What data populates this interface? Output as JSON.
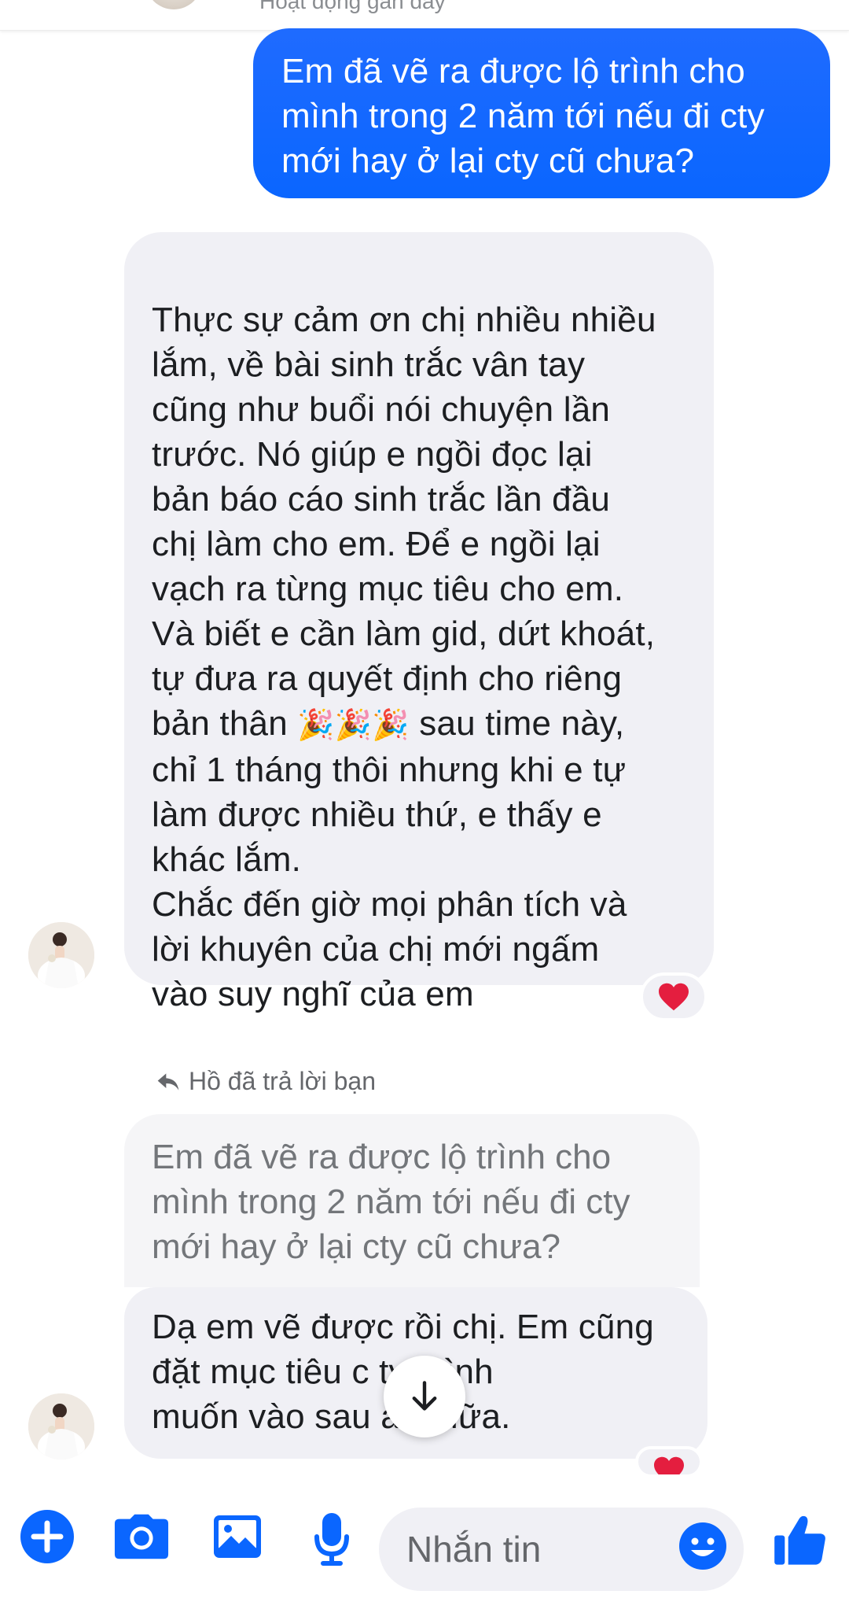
{
  "header": {
    "status_text": "Hoạt động gần đây"
  },
  "messages": {
    "outgoing_1": "Em đã vẽ ra được lộ trình cho\nmình trong 2 năm tới nếu đi cty\nmới hay ở lại cty cũ chưa?",
    "incoming_1": {
      "lines": [
        "Thực sự cảm ơn chị nhiều nhiều",
        "lắm, về bài sinh trắc vân tay",
        "cũng như buổi nói chuyện lần",
        "trước. Nó giúp e ngồi đọc lại",
        "bản báo cáo sinh trắc lần đầu",
        "chị làm cho em. Để e ngồi lại",
        "vạch ra từng mục tiêu cho em.",
        "Và biết e cần làm gid, dứt khoát,",
        "tự đưa ra quyết định cho riêng"
      ],
      "emoji_line_before": "bản thân ",
      "emojis": "🎉🎉🎉",
      "emoji_line_after": " sau time này,",
      "lines_after": [
        "chỉ 1 tháng thôi nhưng khi e tự",
        "làm được nhiều thứ, e thấy e",
        "khác lắm.",
        "Chắc đến giờ mọi phân tích và",
        "lời khuyên của chị mới ngấm",
        "vào suy nghĩ của em"
      ],
      "reaction": "heart"
    },
    "reply_label": "Hồ đã trả lời bạn",
    "quoted": "Em đã vẽ ra được lộ trình cho\nmình trong 2 năm tới nếu đi cty\nmới hay ở lại cty cũ chưa?",
    "incoming_2": "Dạ em vẽ được rồi chị. Em cũng\nđặt mục tiêu c      ty mình\nmuốn vào sau      ăm nữa.",
    "incoming_2_reaction": "heart"
  },
  "composer": {
    "placeholder": "Nhắn tin",
    "icons": [
      "plus-icon",
      "camera-icon",
      "gallery-icon",
      "microphone-icon",
      "emoji-icon",
      "thumbs-up-icon"
    ]
  },
  "colors": {
    "accent": "#0a66ff",
    "outgoing_bubble": "#0a66ff",
    "incoming_bubble": "#f0f0f5",
    "heart": "#e41e3f"
  }
}
